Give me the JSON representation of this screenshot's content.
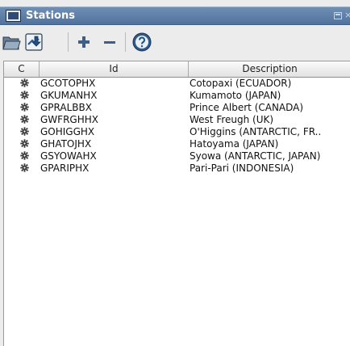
{
  "window": {
    "title": "Stations"
  },
  "toolbar": {
    "buttons": [
      "open-folder-icon",
      "import-icon",
      "add-icon",
      "remove-icon",
      "help-icon"
    ]
  },
  "table": {
    "columns": [
      "C",
      "Id",
      "Description"
    ],
    "rows": [
      {
        "id": "GCOTOPHX",
        "description": "Cotopaxi (ECUADOR)"
      },
      {
        "id": "GKUMANHX",
        "description": "Kumamoto (JAPAN)"
      },
      {
        "id": "GPRALBBX",
        "description": "Prince Albert (CANADA)"
      },
      {
        "id": "GWFRGHHX",
        "description": "West Freugh (UK)"
      },
      {
        "id": "GOHIGGHX",
        "description": "O'Higgins (ANTARCTIC, FR.."
      },
      {
        "id": "GHATOJHX",
        "description": "Hatoyama (JAPAN)"
      },
      {
        "id": "GSYOWAHX",
        "description": "Syowa (ANTARCTIC, JAPAN)"
      },
      {
        "id": "GPARIPHX",
        "description": "Pari-Pari (INDONESIA)"
      }
    ]
  }
}
